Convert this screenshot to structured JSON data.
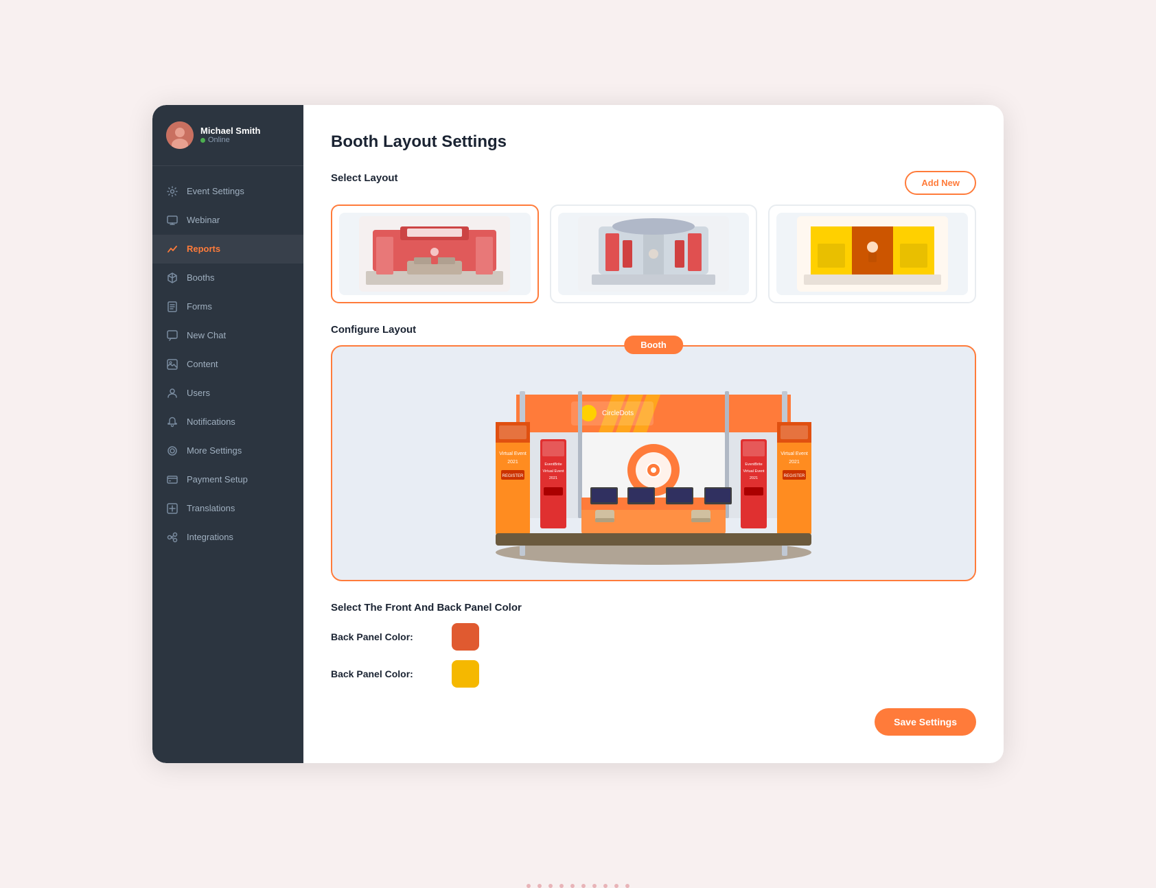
{
  "app": {
    "title": "Booth Layout Settings"
  },
  "user": {
    "name": "Michael Smith",
    "status": "Online"
  },
  "sidebar": {
    "items": [
      {
        "id": "event-settings",
        "label": "Event Settings",
        "icon": "settings",
        "active": false
      },
      {
        "id": "webinar",
        "label": "Webinar",
        "icon": "monitor",
        "active": false
      },
      {
        "id": "reports",
        "label": "Reports",
        "icon": "chart",
        "active": true
      },
      {
        "id": "booths",
        "label": "Booths",
        "icon": "cube",
        "active": false
      },
      {
        "id": "forms",
        "label": "Forms",
        "icon": "list",
        "active": false
      },
      {
        "id": "new-chat",
        "label": "New Chat",
        "icon": "chat",
        "active": false
      },
      {
        "id": "content",
        "label": "Content",
        "icon": "image",
        "active": false
      },
      {
        "id": "users",
        "label": "Users",
        "icon": "user",
        "active": false
      },
      {
        "id": "notifications",
        "label": "Notifications",
        "icon": "bell",
        "active": false
      },
      {
        "id": "more-settings",
        "label": "More Settings",
        "icon": "more",
        "active": false
      },
      {
        "id": "payment-setup",
        "label": "Payment Setup",
        "icon": "payment",
        "active": false
      },
      {
        "id": "translations",
        "label": "Translations",
        "icon": "translate",
        "active": false
      },
      {
        "id": "integrations",
        "label": "Integrations",
        "icon": "integrations",
        "active": false
      }
    ]
  },
  "main": {
    "page_title": "Booth Layout Settings",
    "select_layout_label": "Select Layout",
    "configure_layout_label": "Configure Layout",
    "add_new_label": "Add New",
    "booth_badge_label": "Booth",
    "color_section_title": "Select The Front And Back Panel Color",
    "back_panel_color_label_1": "Back Panel Color:",
    "back_panel_color_label_2": "Back Panel Color:",
    "color_1": "#e05a30",
    "color_2": "#f5b800",
    "save_settings_label": "Save Settings"
  }
}
